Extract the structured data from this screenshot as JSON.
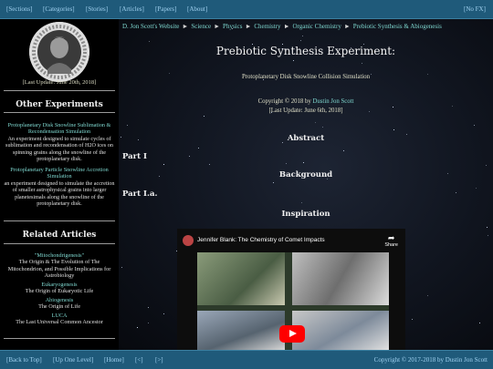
{
  "topnav": {
    "sections": "[Sections]",
    "categories": "[Categories]",
    "stories": "[Stories]",
    "articles": "[Articles]",
    "papers": "[Papers]",
    "about": "[About]",
    "nofx": "[No FX]"
  },
  "sidebar": {
    "last_update": "[Last Update: June 20th, 2018]",
    "other_experiments_heading": "Other Experiments",
    "experiments": [
      {
        "link": "Protoplanetary Disk Snowline Sublimation & Recondensation Simulation",
        "desc": "An experiment designed to simulate cycles of sublimation and recondensation of H2O ices on spinning grains along the snowline of the protoplanetary disk."
      },
      {
        "link": "Protoplanetary Particle Snowline Accretion Simulation",
        "desc": "an experiment designed to simulate the accretion of smaller astrophysical grains into larger planetesimals along the snowline of the protoplanetary disk."
      }
    ],
    "related_heading": "Related Articles",
    "related": [
      {
        "link": "\"Mitochondrigenesis\"",
        "desc": "The Origin & The Evolution of The Mitochondrion, and Possible Implications for Astrobiology"
      },
      {
        "link": "Eukaryogenesis",
        "desc": "The Origin of Eukaryotic Life"
      },
      {
        "link": "Abiogenesis",
        "desc": "The Origin of Life"
      },
      {
        "link": "LUCA",
        "desc": "The Last Universal Common Ancestor"
      }
    ]
  },
  "breadcrumb": [
    "D. Jon Scott's Website",
    "Science",
    "Physics",
    "Chemistry",
    "Organic Chemistry",
    "Prebiotic Synthesis & Abiogenesis"
  ],
  "breadcrumb_sep": "►",
  "main": {
    "title": "Prebiotic Synthesis Experiment:",
    "subtitle": "Protoplanetary Disk Snowline Collision Simulation",
    "copyright_prefix": "Copyright © 2018 by",
    "author": "Dustin Jon Scott",
    "last_update": "[Last Update: June 6th, 2018]",
    "abstract": "Abstract",
    "part1": "Part I",
    "background": "Background",
    "part1a": "Part I.a.",
    "inspiration": "Inspiration"
  },
  "video": {
    "title": "Jennifer Blank: The Chemistry of Comet Impacts",
    "share": "Share"
  },
  "bottombar": {
    "back_to_top": "[Back to Top]",
    "up_one_level": "[Up One Level]",
    "home": "[Home]",
    "prev": "[<]",
    "next": "[>]",
    "copyright": "Copyright © 2017-2018 by Dustin Jon Scott"
  },
  "colors": {
    "bar": "#1f5a7a",
    "link": "#7fd8d0",
    "topnav_link": "#9fd0ef"
  }
}
